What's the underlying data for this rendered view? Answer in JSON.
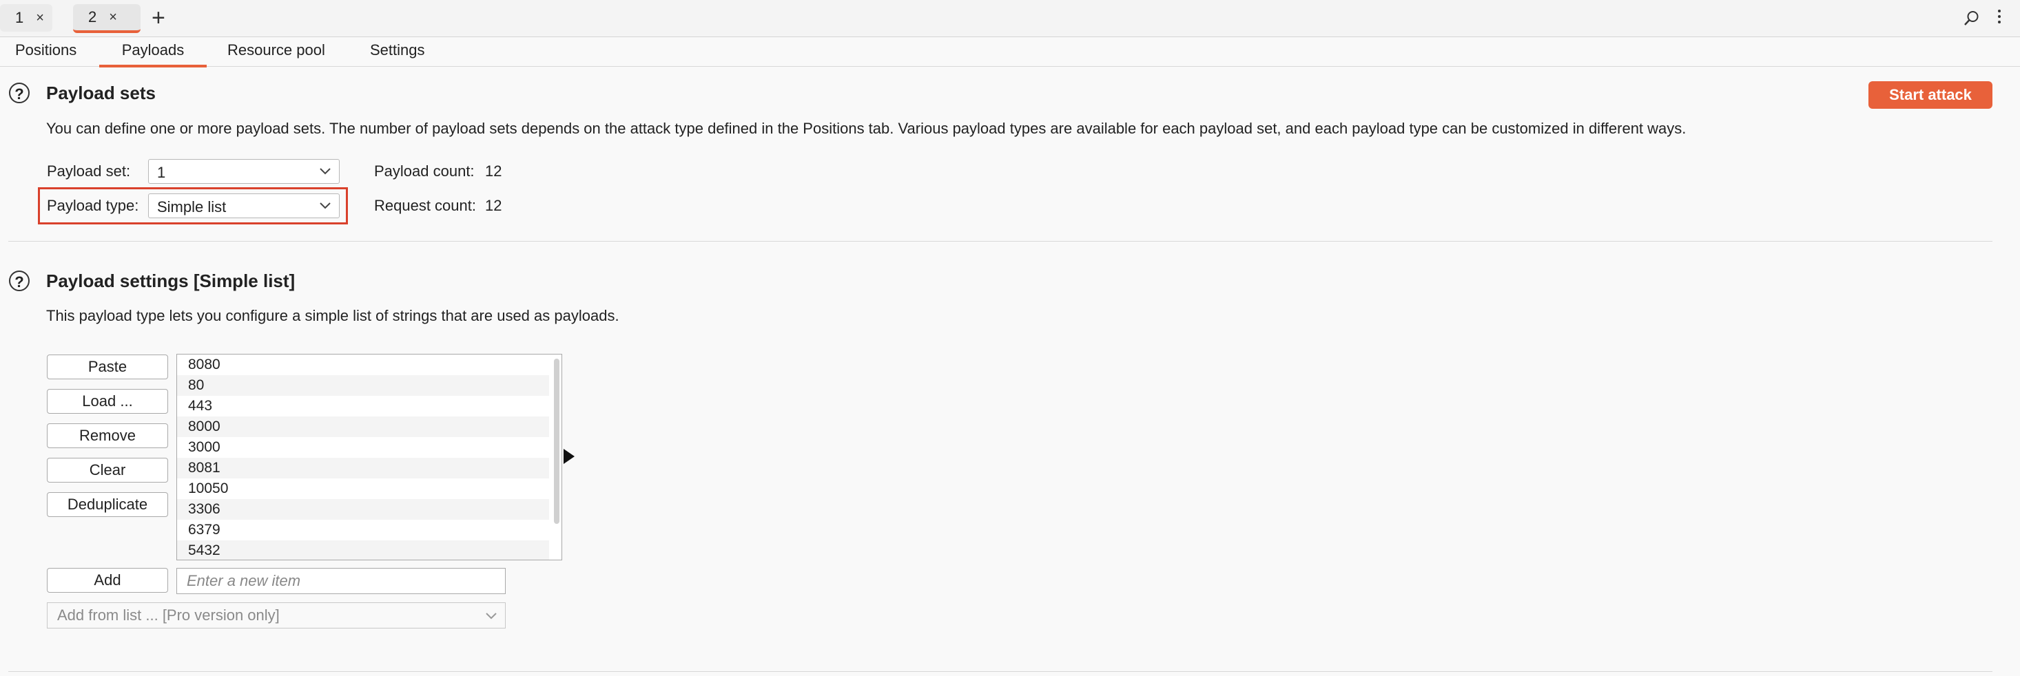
{
  "attack_tabs": [
    {
      "label": "1",
      "close": "×"
    },
    {
      "label": "2",
      "close": "×"
    }
  ],
  "new_tab": "+",
  "icons": {
    "search": "search-icon",
    "menu": "kebab-menu-icon",
    "help": "question-circle-icon"
  },
  "subtabs": [
    "Positions",
    "Payloads",
    "Resource pool",
    "Settings"
  ],
  "active_subtab": "Payloads",
  "accent_color": "#e8613a",
  "highlight_color": "#d9412c",
  "payload_sets": {
    "help": "?",
    "title": "Payload sets",
    "start_attack": "Start attack",
    "description": "You can define one or more payload sets. The number of payload sets depends on the attack type defined in the Positions tab. Various payload types are available for each payload set, and each payload type can be customized in different ways.",
    "set_label": "Payload set:",
    "set_value": "1",
    "type_label": "Payload type:",
    "type_value": "Simple list",
    "payload_count_label": "Payload count:",
    "payload_count": "12",
    "request_count_label": "Request count:",
    "request_count": "12"
  },
  "payload_settings": {
    "help": "?",
    "title": "Payload settings [Simple list]",
    "description": "This payload type lets you configure a simple list of strings that are used as payloads.",
    "buttons": {
      "paste": "Paste",
      "load": "Load ...",
      "remove": "Remove",
      "clear": "Clear",
      "deduplicate": "Deduplicate",
      "add": "Add"
    },
    "items": [
      "8080",
      "80",
      "443",
      "8000",
      "3000",
      "8081",
      "10050",
      "3306",
      "6379",
      "5432"
    ],
    "new_item_placeholder": "Enter a new item",
    "add_from_list": "Add from list ... [Pro version only]"
  }
}
